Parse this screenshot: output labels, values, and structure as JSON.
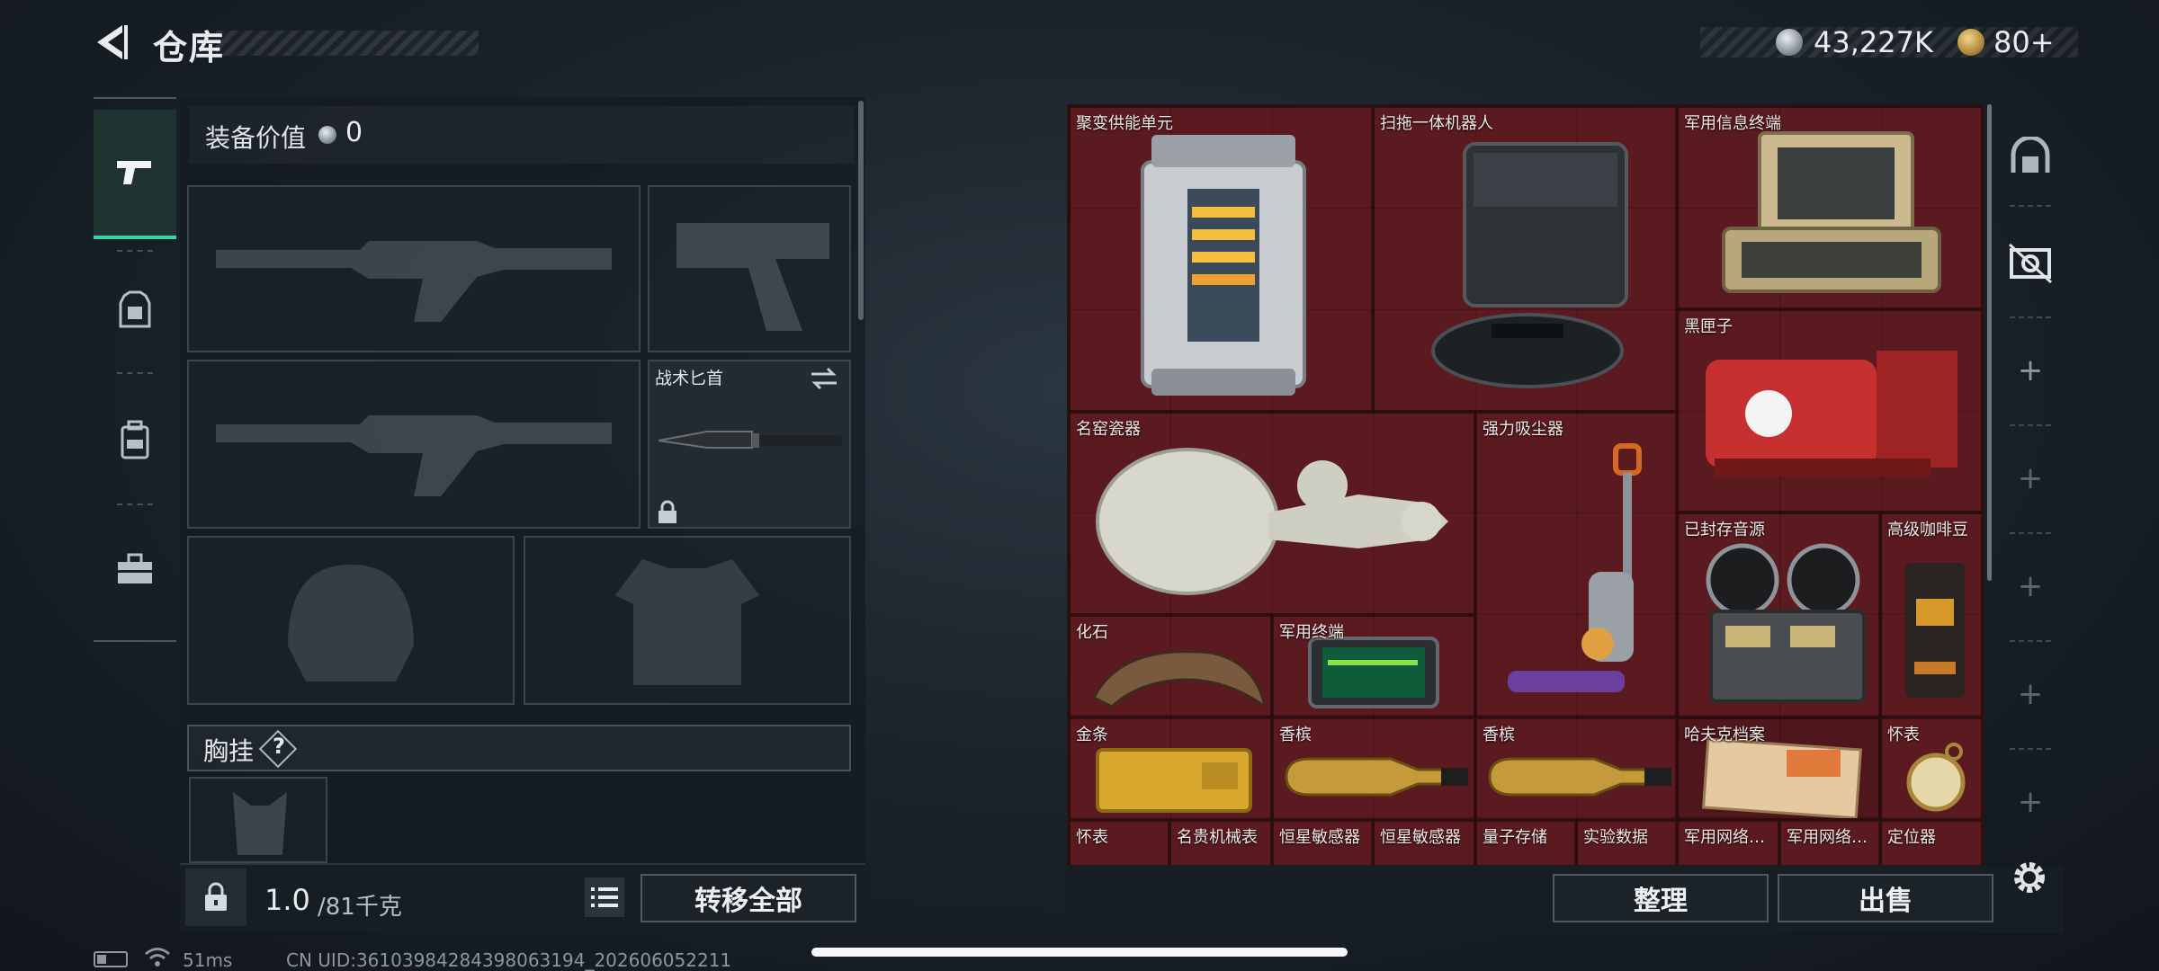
{
  "header": {
    "title": "仓库",
    "currency": [
      {
        "icon": "silver-coin-icon",
        "value": "43,227K"
      },
      {
        "icon": "gold-coin-icon",
        "value": "80+"
      }
    ]
  },
  "equipment": {
    "value_label": "装备价值",
    "value": "0",
    "knife_label": "战术匕首",
    "chest_rig_label": "胸挂",
    "help_mark": "?",
    "weight_current": "1.0",
    "weight_max": "/81千克",
    "transfer_all": "转移全部"
  },
  "stash": {
    "items": [
      {
        "label": "聚变供能单元"
      },
      {
        "label": "扫拖一体机器人"
      },
      {
        "label": "军用信息终端"
      },
      {
        "label": "黑匣子"
      },
      {
        "label": "名窑瓷器"
      },
      {
        "label": "强力吸尘器"
      },
      {
        "label": "已封存音源"
      },
      {
        "label": "高级咖啡豆"
      },
      {
        "label": "化石"
      },
      {
        "label": "军用终端"
      },
      {
        "label": "金条"
      },
      {
        "label": "香槟"
      },
      {
        "label": "香槟"
      },
      {
        "label": "哈夫克档案"
      },
      {
        "label": "怀表"
      },
      {
        "label": "怀表"
      },
      {
        "label": "名贵机械表"
      },
      {
        "label": "恒星敏感器"
      },
      {
        "label": "恒星敏感器"
      },
      {
        "label": "量子存储"
      },
      {
        "label": "实验数据"
      },
      {
        "label": "军用网络…"
      },
      {
        "label": "军用网络…"
      },
      {
        "label": "定位器"
      }
    ],
    "sort": "整理",
    "sell": "出售"
  },
  "status": {
    "ping": "51ms",
    "uid": "CN UID:36103984284398063194_202606052211"
  },
  "colors": {
    "stash_bg": "#5a1a20",
    "tab_accent": "#37d6a0"
  }
}
